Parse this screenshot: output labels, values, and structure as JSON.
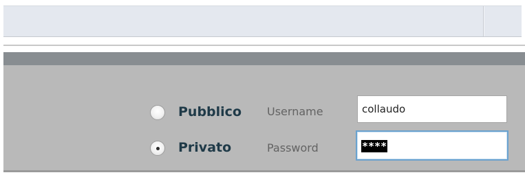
{
  "login": {
    "access_options": [
      {
        "label": "Pubblico",
        "selected": false
      },
      {
        "label": "Privato",
        "selected": true
      }
    ],
    "username": {
      "label": "Username",
      "value": "collaudo"
    },
    "password": {
      "label": "Password",
      "masked_value": "****",
      "focused": true
    }
  },
  "colors": {
    "top_bar": "#e4e8ef",
    "band": "#888d91",
    "panel": "#b9b9b9",
    "radio_label": "#1f3a48",
    "field_label": "#636363",
    "focus_border": "#6aa2cf"
  }
}
